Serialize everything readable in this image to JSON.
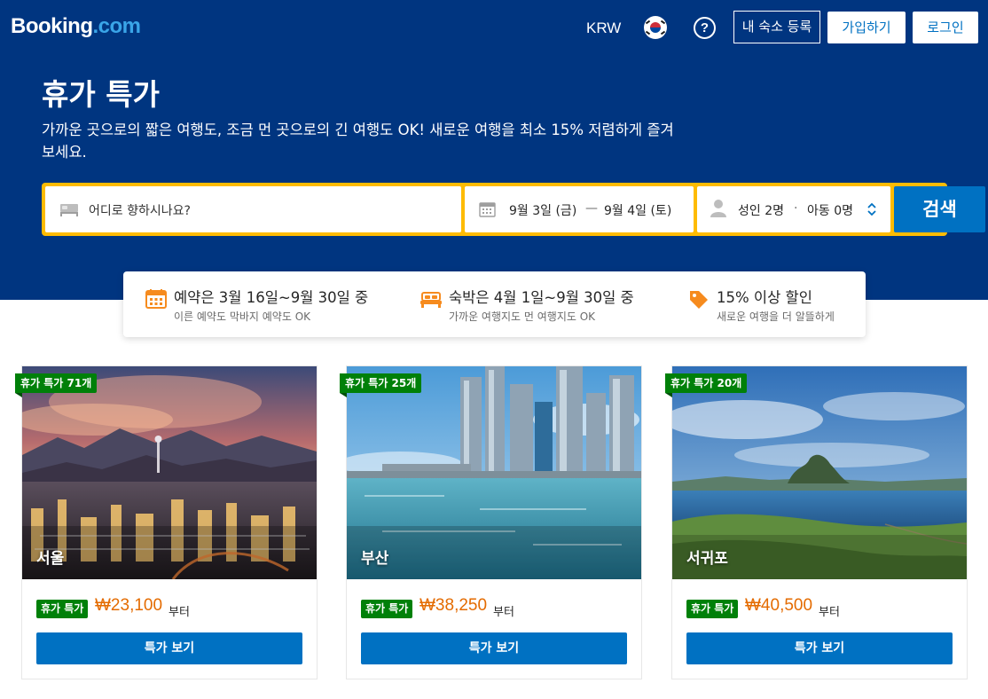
{
  "header": {
    "logo_main": "Booking",
    "logo_suffix": ".com",
    "currency": "KRW",
    "help_symbol": "?",
    "list_property_label": "내 숙소 등록",
    "signup_label": "가입하기",
    "login_label": "로그인"
  },
  "hero": {
    "title": "휴가 특가",
    "subtitle": "가까운 곳으로의 짧은 여행도, 조금 먼 곳으로의 긴 여행도 OK! 새로운 여행을 최소 15% 저렴하게 즐겨보세요."
  },
  "search": {
    "destination_placeholder": "어디로 향하시나요?",
    "checkin": "9월 3일 (금)",
    "dash": "—",
    "checkout": "9월 4일 (토)",
    "adults": "성인 2명",
    "separator": "·",
    "children": "아동 0명",
    "search_label": "검색"
  },
  "info": [
    {
      "icon": "calendar-icon",
      "title": "예약은 3월 16일~9월 30일 중",
      "desc": "이른 예약도 막바지 예약도 OK"
    },
    {
      "icon": "bed-icon",
      "title": "숙박은 4월 1일~9월 30일 중",
      "desc": "가까운 여행지도 먼 여행지도 OK"
    },
    {
      "icon": "tag-icon",
      "title": "15% 이상 할인",
      "desc": "새로운 여행을 더 알뜰하게"
    }
  ],
  "cards": [
    {
      "city": "서울",
      "ribbon": "휴가 특가 71개",
      "deal_tag": "휴가 특가",
      "price": "₩23,100",
      "from": "부터",
      "cta": "특가 보기"
    },
    {
      "city": "부산",
      "ribbon": "휴가 특가 25개",
      "deal_tag": "휴가 특가",
      "price": "₩38,250",
      "from": "부터",
      "cta": "특가 보기"
    },
    {
      "city": "서귀포",
      "ribbon": "휴가 특가 20개",
      "deal_tag": "휴가 특가",
      "price": "₩40,500",
      "from": "부터",
      "cta": "특가 보기"
    }
  ],
  "colors": {
    "brand_navy": "#003580",
    "brand_blue": "#0071c2",
    "search_yellow": "#febb02",
    "deal_green": "#008009",
    "price_orange": "#e46b00",
    "info_icon_orange": "#f68b1e"
  }
}
